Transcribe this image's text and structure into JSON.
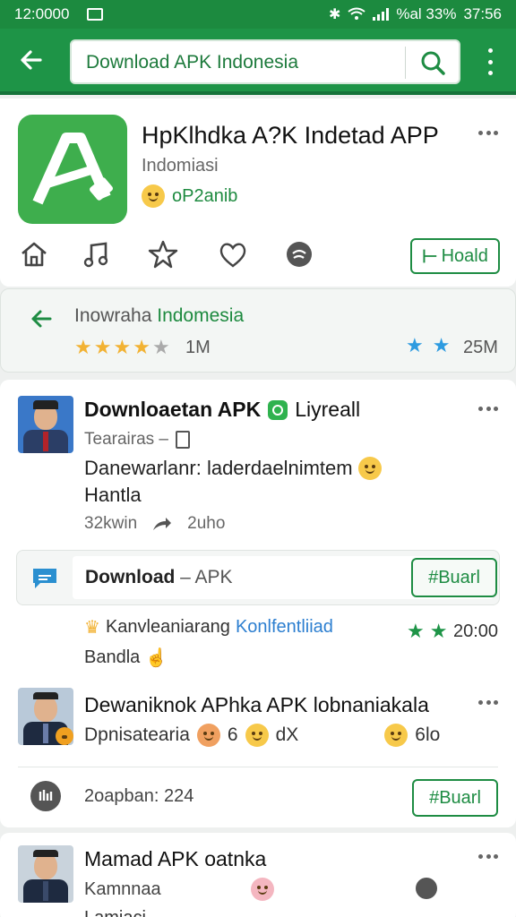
{
  "status_bar": {
    "time": "12:0000",
    "battery": "%al 33%",
    "clock": "37:56"
  },
  "search": {
    "value": "Download APK Indonesia"
  },
  "app": {
    "title": "HpKlhdka A?K Indetad APP",
    "subtitle": "Indomiasi",
    "developer": "oP2anib",
    "install_label": "Hoald"
  },
  "region": {
    "label_prefix": "Inowraha",
    "label_highlight": "Indomesia",
    "count_left": "1M",
    "count_right": "25M"
  },
  "post1": {
    "title": "Downloaetan APK",
    "tag": "Liyreall",
    "meta": "Tearairas –",
    "body_line1": "Danewarlanr: laderdaelnimtem",
    "body_line2": "Hantla",
    "stat1": "32kwin",
    "stat2": "2uho"
  },
  "link_card": {
    "title": "Download",
    "suffix": " – APK",
    "button": "#Buarl"
  },
  "promo": {
    "text": "Kanvleaniarang",
    "highlight": "Konlfentliiad",
    "rating": "20:00",
    "sub": "Bandla"
  },
  "post2": {
    "title": "Dewaniknok APhka APK lobnaniakala",
    "meta": "Dpnisatearia",
    "meta2": "6",
    "meta3": "dX",
    "meta4": "6lo"
  },
  "row_action": {
    "label": "2oapban: 224",
    "button": "#Buarl"
  },
  "post3": {
    "title": "Mamad APK oatnka",
    "meta": "Kamnnaa",
    "footer": "Lamiaci"
  },
  "colors": {
    "primary": "#1e9447",
    "accent_star": "#f2b233",
    "link_blue": "#2d7fd0"
  }
}
